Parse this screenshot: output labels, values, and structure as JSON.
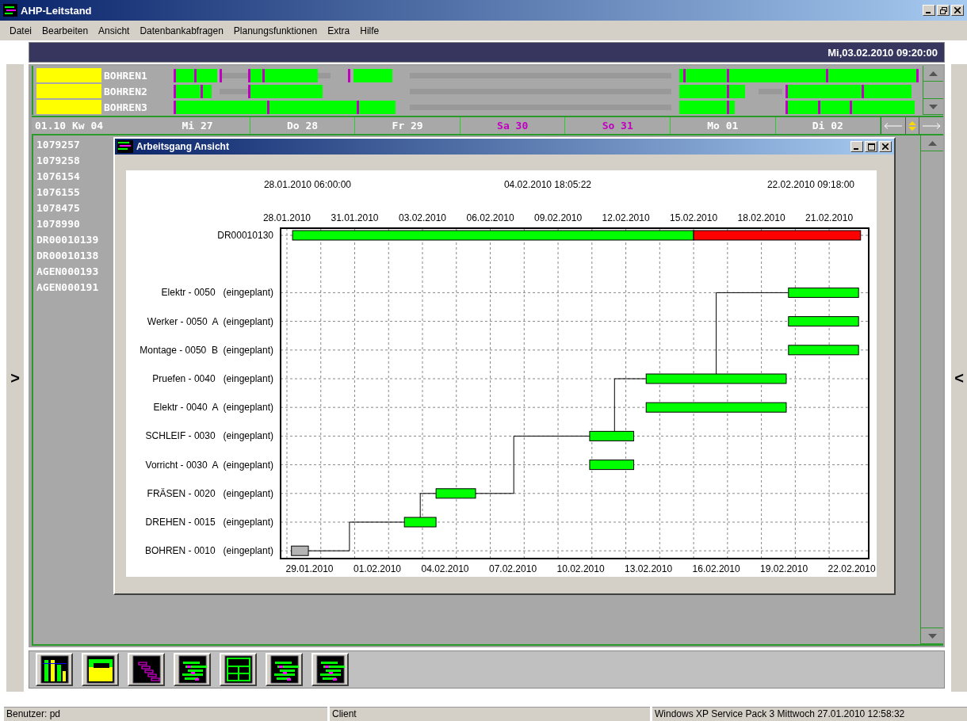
{
  "window": {
    "title": "AHP-Leitstand"
  },
  "menu": [
    "Datei",
    "Bearbeiten",
    "Ansicht",
    "Datenbankabfragen",
    "Planungsfunktionen",
    "Extra",
    "Hilfe"
  ],
  "header": {
    "datetime": "Mi,03.02.2010 09:20:00"
  },
  "machines": [
    {
      "name": "BOHREN1"
    },
    {
      "name": "BOHREN2"
    },
    {
      "name": "BOHREN3"
    }
  ],
  "timeline": {
    "week": "01.10 Kw 04",
    "days": [
      {
        "label": "Mi 27",
        "weekend": false
      },
      {
        "label": "Do 28",
        "weekend": false
      },
      {
        "label": "Fr 29",
        "weekend": false
      },
      {
        "label": "Sa 30",
        "weekend": true
      },
      {
        "label": "So 31",
        "weekend": true
      },
      {
        "label": "Mo 01",
        "weekend": false
      },
      {
        "label": "Di 02",
        "weekend": false
      }
    ]
  },
  "orders": [
    "1079257",
    "1079258",
    "1076154",
    "1076155",
    "1078475",
    "1078990",
    "DR00010139",
    "DR00010138",
    "AGEN000193",
    "AGEN000191"
  ],
  "dialog": {
    "title": "Arbeitsgang Ansicht",
    "header_times": [
      "28.01.2010 06:00:00",
      "04.02.2010 18:05:22",
      "22.02.2010 09:18:00"
    ],
    "bottom_axis_labels": [
      "29.01.2010",
      "01.02.2010",
      "04.02.2010",
      "07.02.2010",
      "10.02.2010",
      "13.02.2010",
      "16.02.2010",
      "19.02.2010",
      "22.02.2010"
    ],
    "top_axis_labels": [
      "28.01.2010",
      "31.01.2010",
      "03.02.2010",
      "06.02.2010",
      "09.02.2010",
      "12.02.2010",
      "15.02.2010",
      "18.02.2010",
      "21.02.2010"
    ],
    "tasks": [
      {
        "label": "DR00010130"
      },
      {
        "label": "Elektr - 0050   (eingeplant)"
      },
      {
        "label": "Werker - 0050  A  (eingeplant)"
      },
      {
        "label": "Montage - 0050  B  (eingeplant)"
      },
      {
        "label": "Pruefen - 0040   (eingeplant)"
      },
      {
        "label": "Elektr - 0040  A  (eingeplant)"
      },
      {
        "label": "SCHLEIF - 0030   (eingeplant)"
      },
      {
        "label": "Vorricht - 0030  A  (eingeplant)"
      },
      {
        "label": "FRÄSEN - 0020   (eingeplant)"
      },
      {
        "label": "DREHEN - 0015   (eingeplant)"
      },
      {
        "label": "BOHREN - 0010   (eingeplant)"
      }
    ]
  },
  "side_toggles": [
    ">",
    "<"
  ],
  "status_bar": [
    "Benutzer: pd",
    "Client",
    "Windows XP Service Pack 3 Mittwoch 27.01.2010 12:58:32"
  ]
}
